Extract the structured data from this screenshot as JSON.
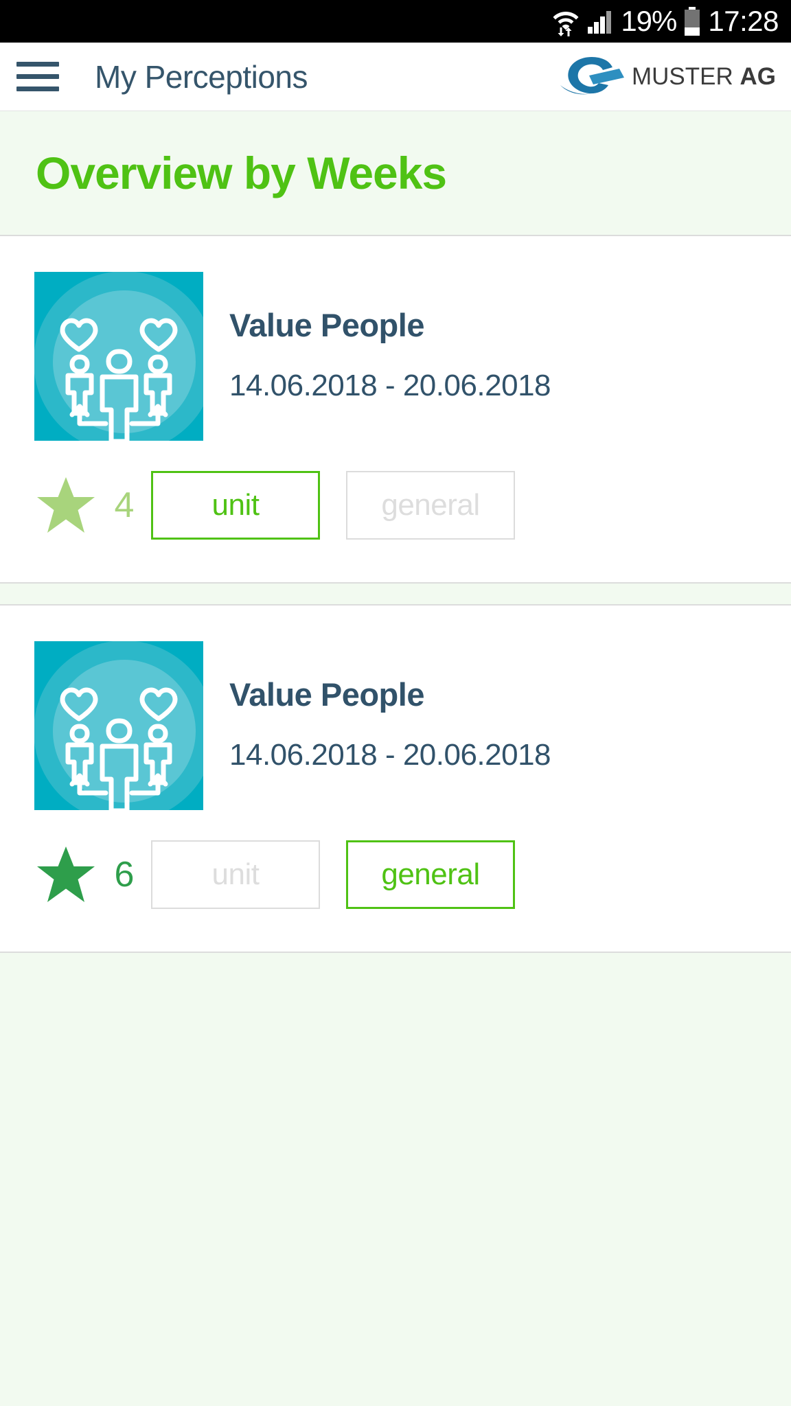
{
  "statusbar": {
    "wifi_icon": "wifi-transfer-icon",
    "signal_icon": "cellular-signal-icon",
    "battery_percent": "19%",
    "battery_icon": "battery-low-icon",
    "time": "17:28"
  },
  "appbar": {
    "menu_icon": "hamburger-menu-icon",
    "title": "My Perceptions",
    "brand_mark_icon": "muster-ag-logo-icon",
    "brand_name": "MUSTER",
    "brand_suffix": "AG"
  },
  "section": {
    "title": "Overview by Weeks",
    "background": "#f2faf0",
    "title_color": "#4fc214"
  },
  "colors": {
    "accent_green": "#4fc214",
    "inactive_gray": "#dddddd",
    "text_slate": "#31526a",
    "icon_teal": "#00adc2",
    "star_light_green": "#a8d47c",
    "star_dark_green": "#2e9e4b"
  },
  "cards": [
    {
      "icon": "value-people-icon",
      "title": "Value People",
      "date_range": "14.06.2018 - 20.06.2018",
      "star_icon": "star-icon",
      "star_color": "#a8d47c",
      "rating": "4",
      "buttons": [
        {
          "label": "unit",
          "state": "active"
        },
        {
          "label": "general",
          "state": "inactive"
        }
      ]
    },
    {
      "icon": "value-people-icon",
      "title": "Value People",
      "date_range": "14.06.2018 - 20.06.2018",
      "star_icon": "star-icon",
      "star_color": "#2e9e4b",
      "rating": "6",
      "buttons": [
        {
          "label": "unit",
          "state": "inactive"
        },
        {
          "label": "general",
          "state": "active"
        }
      ]
    }
  ]
}
